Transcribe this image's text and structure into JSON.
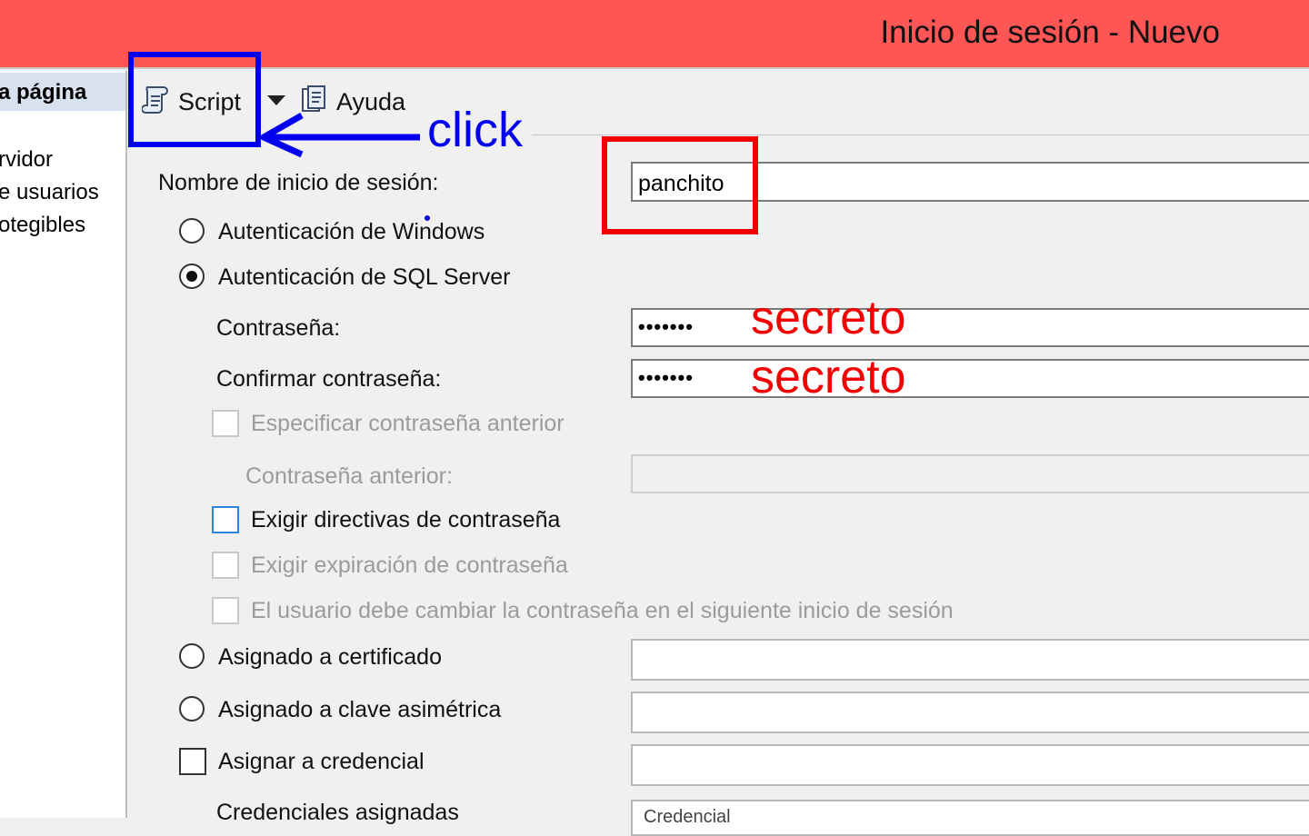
{
  "window": {
    "title": "Inicio de sesión - Nuevo"
  },
  "sidebar": {
    "header": "a página",
    "items": [
      "rvidor",
      "e usuarios",
      "otegibles"
    ]
  },
  "toolbar": {
    "script_label": "Script",
    "help_label": "Ayuda"
  },
  "annotation": {
    "click_text": "click",
    "password_hint": "secreto",
    "confirm_hint": "secreto",
    "colors": {
      "blue": "#0000ee",
      "red": "#f40000"
    }
  },
  "form": {
    "login_name_label": "Nombre de inicio de sesión:",
    "login_name_value": "panchito",
    "windows_auth_label": "Autenticación de Windows",
    "sql_auth_label": "Autenticación de SQL Server",
    "password_label": "Contraseña:",
    "password_value": "•••••••",
    "confirm_label": "Confirmar contraseña:",
    "confirm_value": "•••••••",
    "specify_old_label": "Especificar contraseña anterior",
    "old_password_label": "Contraseña anterior:",
    "enforce_policy_label": "Exigir directivas de contraseña",
    "enforce_expiration_label": "Exigir expiración de contraseña",
    "must_change_label": "El usuario debe cambiar la contraseña en el siguiente inicio de sesión",
    "certificate_label": "Asignado a certificado",
    "asym_key_label": "Asignado a clave asimétrica",
    "credential_label": "Asignar a credencial",
    "mapped_credentials_label": "Credenciales asignadas",
    "credential_column_label": "Credencial"
  }
}
